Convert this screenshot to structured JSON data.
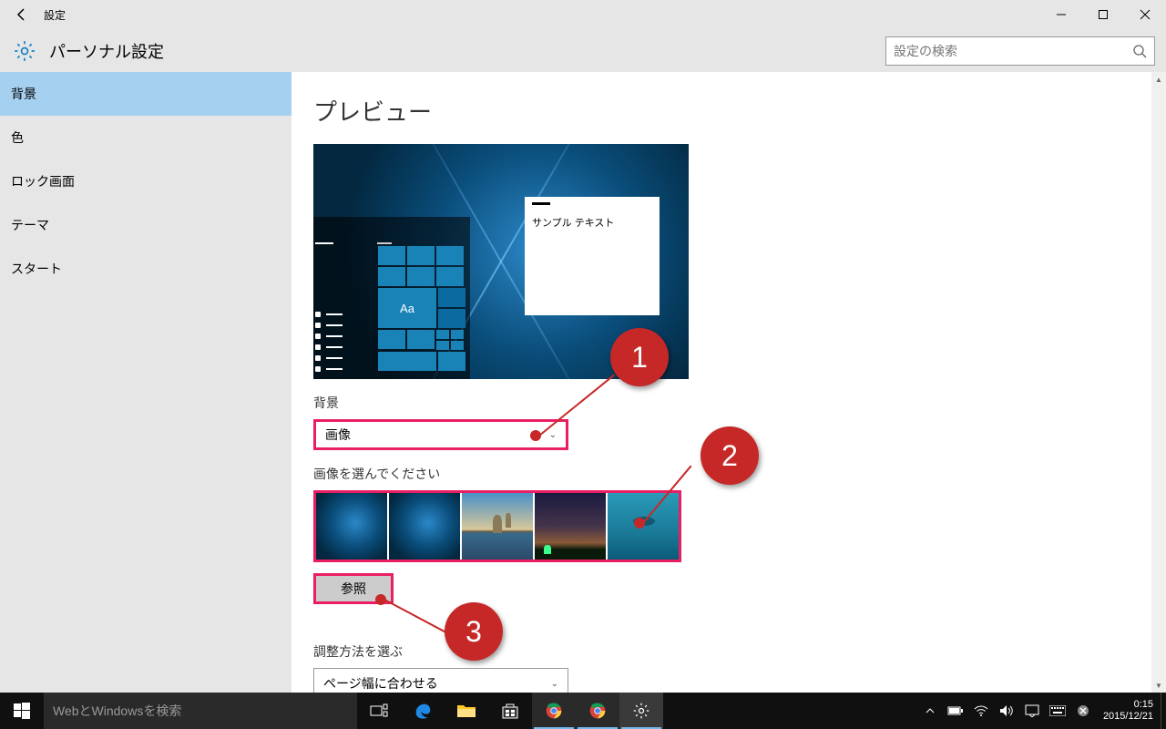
{
  "titlebar": {
    "title": "設定"
  },
  "header": {
    "page_title": "パーソナル設定",
    "search_placeholder": "設定の検索"
  },
  "sidebar": {
    "items": [
      "背景",
      "色",
      "ロック画面",
      "テーマ",
      "スタート"
    ],
    "active_index": 0
  },
  "content": {
    "preview_heading": "プレビュー",
    "preview_sample_text": "サンプル テキスト",
    "preview_tile_text": "Aa",
    "background_label": "背景",
    "background_dropdown": "画像",
    "choose_image_label": "画像を選んでください",
    "browse_label": "参照",
    "fit_label": "調整方法を選ぶ",
    "fit_dropdown": "ページ幅に合わせる"
  },
  "callouts": {
    "b1": "1",
    "b2": "2",
    "b3": "3"
  },
  "taskbar": {
    "search_placeholder": "WebとWindowsを検索",
    "time": "0:15",
    "date": "2015/12/21"
  }
}
